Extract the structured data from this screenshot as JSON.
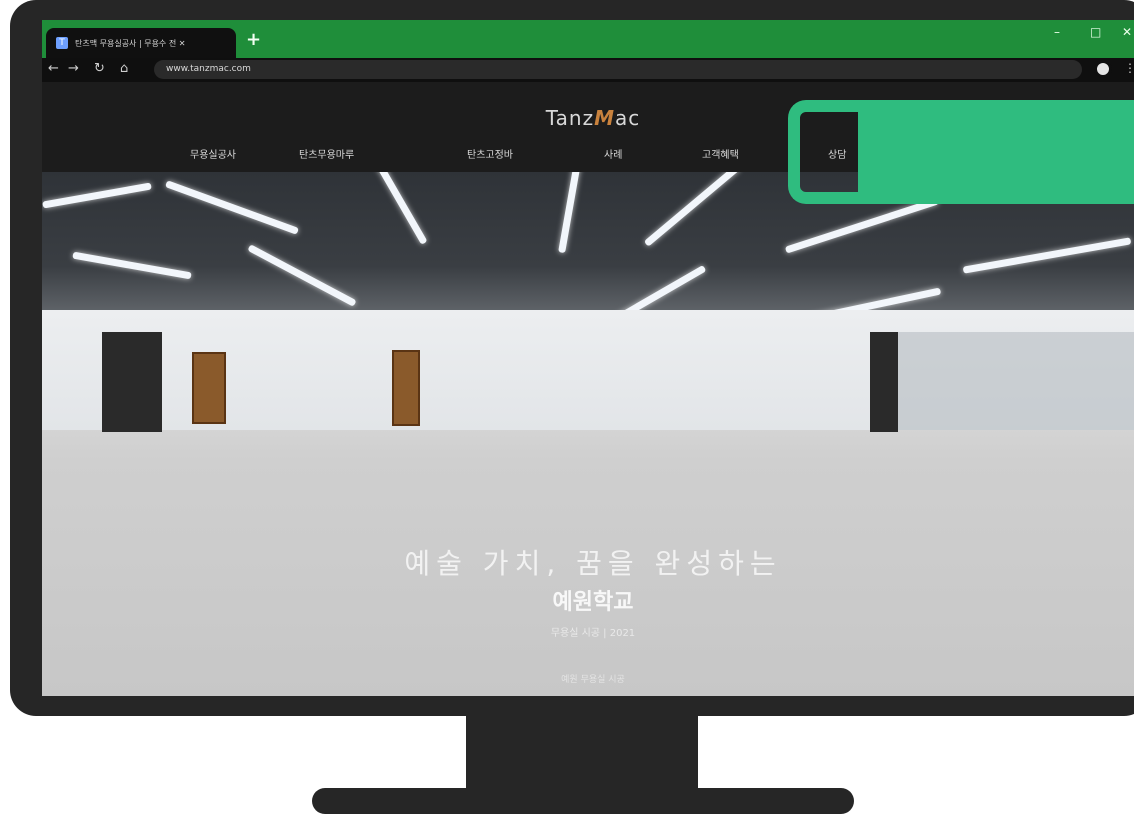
{
  "browser": {
    "tab": {
      "title": "탄츠맥 무용실공사 | 무용수 전 ✕"
    },
    "new_tab_label": "+",
    "window": {
      "minimize": "–",
      "maximize": "□",
      "close": "✕"
    },
    "url": "www.tanzmac.com",
    "icons": {
      "back": "back-arrow-icon",
      "forward": "forward-arrow-icon",
      "reload": "reload-icon",
      "home": "home-icon",
      "profile": "profile-icon",
      "menu": "more-menu-icon"
    }
  },
  "site": {
    "logo": {
      "prefix": "Tanz",
      "m": "M",
      "suffix": "ac"
    },
    "nav": [
      "무용실공사",
      "탄츠무용마루",
      "탄츠고정바",
      "사례",
      "고객혜택",
      "상담"
    ]
  },
  "hero": {
    "subtitle": "예술 가치, 꿈을 완성하는",
    "title": "예원학교",
    "small": "무용실 시공 | 2021",
    "bottom": "예원 무용실 시공"
  },
  "colors": {
    "tabbar": "#1f8e3a",
    "highlight": "#2fbc7f",
    "logo_accent": "#c9823d"
  }
}
